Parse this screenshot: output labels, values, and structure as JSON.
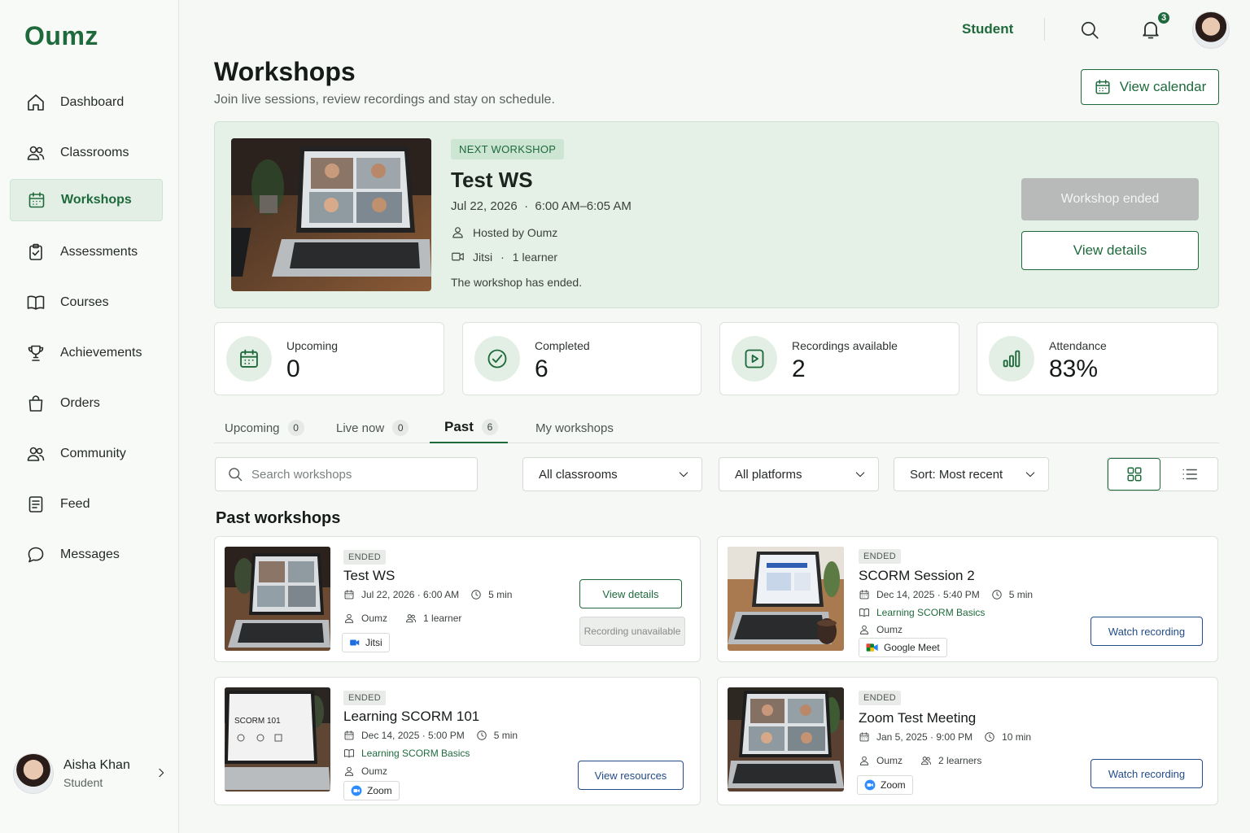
{
  "app": {
    "logo": "Oumz"
  },
  "sidebar": {
    "items": [
      {
        "label": "Dashboard",
        "icon": "home-icon"
      },
      {
        "label": "Classrooms",
        "icon": "users-icon"
      },
      {
        "label": "Workshops",
        "icon": "calendar-icon",
        "active": true
      },
      {
        "label": "Assessments",
        "icon": "clipboard-check-icon"
      },
      {
        "label": "Courses",
        "icon": "book-open-icon"
      },
      {
        "label": "Achievements",
        "icon": "trophy-icon"
      },
      {
        "label": "Orders",
        "icon": "shopping-bag-icon"
      },
      {
        "label": "Community",
        "icon": "users-icon"
      },
      {
        "label": "Feed",
        "icon": "document-icon"
      },
      {
        "label": "Messages",
        "icon": "chat-bubble-icon"
      }
    ],
    "user": {
      "name": "Aisha Khan",
      "role": "Student"
    }
  },
  "header": {
    "role": "Student",
    "notifications": "3"
  },
  "page": {
    "title": "Workshops",
    "subtitle": "Join live sessions, review recordings and stay on schedule.",
    "calendar_button": "View calendar"
  },
  "hero": {
    "tag": "NEXT WORKSHOP",
    "title": "Test WS",
    "date": "Jul 22, 2026",
    "time": "6:00 AM–6:05 AM",
    "host": "Hosted by Oumz",
    "platform": "Jitsi",
    "learners": "1 learner",
    "status": "The workshop has ended.",
    "ended_button": "Workshop ended",
    "details_button": "View details"
  },
  "stats": [
    {
      "label": "Upcoming",
      "value": "0",
      "icon": "calendar-icon"
    },
    {
      "label": "Completed",
      "value": "6",
      "icon": "check-circle-icon"
    },
    {
      "label": "Recordings available",
      "value": "2",
      "icon": "play-icon"
    },
    {
      "label": "Attendance",
      "value": "83%",
      "icon": "bar-chart-icon"
    }
  ],
  "tabs": [
    {
      "label": "Upcoming",
      "count": "0"
    },
    {
      "label": "Live now",
      "count": "0"
    },
    {
      "label": "Past",
      "count": "6",
      "active": true
    },
    {
      "label": "My workshops"
    }
  ],
  "filters": {
    "search_placeholder": "Search workshops",
    "classrooms": "All classrooms",
    "platforms": "All platforms",
    "sort": "Sort: Most recent"
  },
  "section_title": "Past workshops",
  "cards": [
    {
      "tag": "ENDED",
      "title": "Test WS",
      "date": "Jul 22, 2026 · 6:00 AM",
      "duration": "5 min",
      "host": "Oumz",
      "learners": "1 learner",
      "platform": "Jitsi",
      "primary_button": "View details",
      "secondary_button": "Recording unavailable"
    },
    {
      "tag": "ENDED",
      "title": "SCORM Session 2",
      "date": "Dec 14, 2025 · 5:40 PM",
      "duration": "5 min",
      "course": "Learning SCORM Basics",
      "host": "Oumz",
      "platform": "Google Meet",
      "primary_button": "Watch recording"
    },
    {
      "tag": "ENDED",
      "title": "Learning SCORM 101",
      "date": "Dec 14, 2025 · 5:00 PM",
      "duration": "5 min",
      "course": "Learning SCORM Basics",
      "host": "Oumz",
      "platform": "Zoom",
      "primary_button": "View resources",
      "screen_text": "SCORM 101"
    },
    {
      "tag": "ENDED",
      "title": "Zoom Test Meeting",
      "date": "Jan 5, 2025 · 9:00 PM",
      "duration": "10 min",
      "host": "Oumz",
      "learners": "2 learners",
      "platform": "Zoom",
      "primary_button": "Watch recording"
    }
  ],
  "colors": {
    "brand": "#1f6a3c",
    "hero_bg": "#e5f1e7",
    "link_blue": "#234c88"
  }
}
